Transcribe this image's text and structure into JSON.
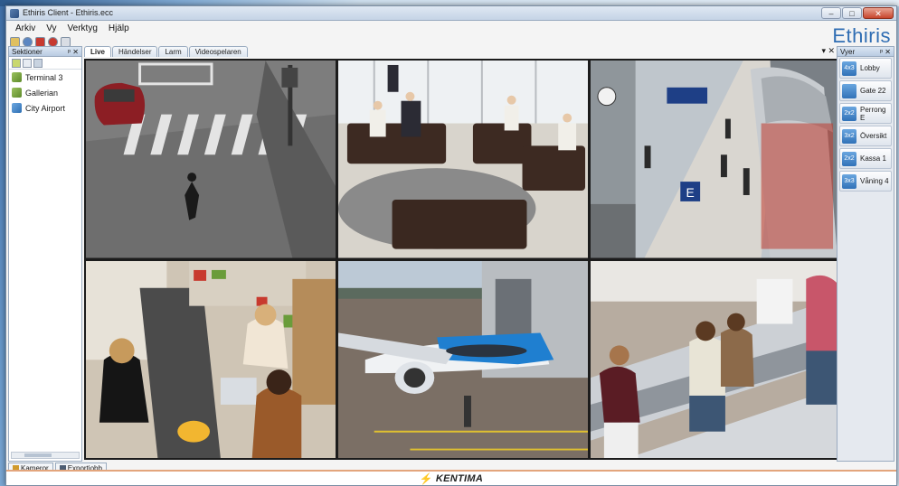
{
  "window": {
    "title": "Ethiris Client - Ethiris.ecc",
    "minimize": "–",
    "maximize": "□",
    "close": "✕"
  },
  "menu": [
    "Arkiv",
    "Vy",
    "Verktyg",
    "Hjälp"
  ],
  "brand": "Ethiris",
  "sections": {
    "header": "Sektioner",
    "controls": "ᵖ ✕",
    "items": [
      {
        "label": "Terminal 3",
        "icon": "camera-group-icon"
      },
      {
        "label": "Gallerian",
        "icon": "camera-group-icon"
      },
      {
        "label": "City Airport",
        "icon": "site-icon"
      }
    ]
  },
  "tabs": [
    "Live",
    "Händelser",
    "Larm",
    "Videospelaren"
  ],
  "tab_controls": "▾ ✕",
  "views": {
    "header": "Vyer",
    "controls": "ᵖ ✕",
    "items": [
      {
        "icon_text": "4x3",
        "label": "Lobby"
      },
      {
        "icon_text": "",
        "label": "Gate 22"
      },
      {
        "icon_text": "2x2",
        "label": "Perrong E"
      },
      {
        "icon_text": "3x2",
        "label": "Översikt"
      },
      {
        "icon_text": "2x2",
        "label": "Kassa 1"
      },
      {
        "icon_text": "3x3",
        "label": "Våning 4"
      }
    ]
  },
  "bottom_tabs": [
    "Kameror",
    "Exportjobb"
  ],
  "footer": {
    "logo": "⚡",
    "text": "KENTIMA"
  },
  "colors": {
    "accent": "#2f6db3",
    "view_icon": "#3172b8",
    "footer_border": "#e3a57c"
  }
}
